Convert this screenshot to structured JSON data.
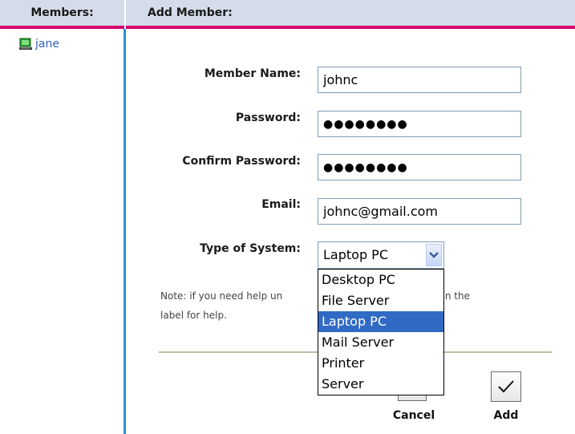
{
  "sidebar": {
    "header": "Members:",
    "members": [
      {
        "name": "jane",
        "icon": "computer-icon"
      }
    ]
  },
  "form": {
    "header": "Add Member:",
    "member_name_label": "Member Name:",
    "member_name_value": "johnc",
    "password_label": "Password:",
    "password_value": "●●●●●●●●",
    "confirm_password_label": "Confirm Password:",
    "confirm_password_value": "●●●●●●●●",
    "email_label": "Email:",
    "email_value": "johnc@gmail.com",
    "system_type_label": "Type of System:",
    "system_type_selected": "Laptop PC",
    "system_type_options": [
      "Desktop PC",
      "File Server",
      "Laptop PC",
      "Mail Server",
      "Printer",
      "Server"
    ],
    "note_visible": [
      "Note: if you need help un",
      "ld, click on the",
      "label for help."
    ]
  },
  "actions": {
    "cancel_label": "Cancel",
    "add_label": "Add"
  },
  "colors": {
    "header_bg": "#d4dceb",
    "header_rule": "#d6006f",
    "sidebar_divider": "#2a8fd6",
    "selection": "#316ac5"
  }
}
